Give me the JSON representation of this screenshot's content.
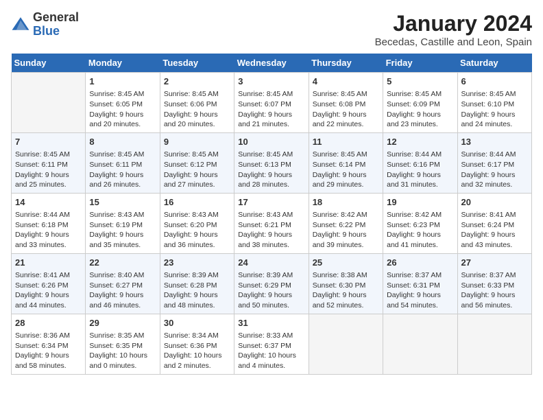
{
  "header": {
    "logo_line1": "General",
    "logo_line2": "Blue",
    "month_title": "January 2024",
    "subtitle": "Becedas, Castille and Leon, Spain"
  },
  "calendar": {
    "days_of_week": [
      "Sunday",
      "Monday",
      "Tuesday",
      "Wednesday",
      "Thursday",
      "Friday",
      "Saturday"
    ],
    "weeks": [
      [
        {
          "day": "",
          "info": ""
        },
        {
          "day": "1",
          "info": "Sunrise: 8:45 AM\nSunset: 6:05 PM\nDaylight: 9 hours\nand 20 minutes."
        },
        {
          "day": "2",
          "info": "Sunrise: 8:45 AM\nSunset: 6:06 PM\nDaylight: 9 hours\nand 20 minutes."
        },
        {
          "day": "3",
          "info": "Sunrise: 8:45 AM\nSunset: 6:07 PM\nDaylight: 9 hours\nand 21 minutes."
        },
        {
          "day": "4",
          "info": "Sunrise: 8:45 AM\nSunset: 6:08 PM\nDaylight: 9 hours\nand 22 minutes."
        },
        {
          "day": "5",
          "info": "Sunrise: 8:45 AM\nSunset: 6:09 PM\nDaylight: 9 hours\nand 23 minutes."
        },
        {
          "day": "6",
          "info": "Sunrise: 8:45 AM\nSunset: 6:10 PM\nDaylight: 9 hours\nand 24 minutes."
        }
      ],
      [
        {
          "day": "7",
          "info": "Sunrise: 8:45 AM\nSunset: 6:11 PM\nDaylight: 9 hours\nand 25 minutes."
        },
        {
          "day": "8",
          "info": "Sunrise: 8:45 AM\nSunset: 6:11 PM\nDaylight: 9 hours\nand 26 minutes."
        },
        {
          "day": "9",
          "info": "Sunrise: 8:45 AM\nSunset: 6:12 PM\nDaylight: 9 hours\nand 27 minutes."
        },
        {
          "day": "10",
          "info": "Sunrise: 8:45 AM\nSunset: 6:13 PM\nDaylight: 9 hours\nand 28 minutes."
        },
        {
          "day": "11",
          "info": "Sunrise: 8:45 AM\nSunset: 6:14 PM\nDaylight: 9 hours\nand 29 minutes."
        },
        {
          "day": "12",
          "info": "Sunrise: 8:44 AM\nSunset: 6:16 PM\nDaylight: 9 hours\nand 31 minutes."
        },
        {
          "day": "13",
          "info": "Sunrise: 8:44 AM\nSunset: 6:17 PM\nDaylight: 9 hours\nand 32 minutes."
        }
      ],
      [
        {
          "day": "14",
          "info": "Sunrise: 8:44 AM\nSunset: 6:18 PM\nDaylight: 9 hours\nand 33 minutes."
        },
        {
          "day": "15",
          "info": "Sunrise: 8:43 AM\nSunset: 6:19 PM\nDaylight: 9 hours\nand 35 minutes."
        },
        {
          "day": "16",
          "info": "Sunrise: 8:43 AM\nSunset: 6:20 PM\nDaylight: 9 hours\nand 36 minutes."
        },
        {
          "day": "17",
          "info": "Sunrise: 8:43 AM\nSunset: 6:21 PM\nDaylight: 9 hours\nand 38 minutes."
        },
        {
          "day": "18",
          "info": "Sunrise: 8:42 AM\nSunset: 6:22 PM\nDaylight: 9 hours\nand 39 minutes."
        },
        {
          "day": "19",
          "info": "Sunrise: 8:42 AM\nSunset: 6:23 PM\nDaylight: 9 hours\nand 41 minutes."
        },
        {
          "day": "20",
          "info": "Sunrise: 8:41 AM\nSunset: 6:24 PM\nDaylight: 9 hours\nand 43 minutes."
        }
      ],
      [
        {
          "day": "21",
          "info": "Sunrise: 8:41 AM\nSunset: 6:26 PM\nDaylight: 9 hours\nand 44 minutes."
        },
        {
          "day": "22",
          "info": "Sunrise: 8:40 AM\nSunset: 6:27 PM\nDaylight: 9 hours\nand 46 minutes."
        },
        {
          "day": "23",
          "info": "Sunrise: 8:39 AM\nSunset: 6:28 PM\nDaylight: 9 hours\nand 48 minutes."
        },
        {
          "day": "24",
          "info": "Sunrise: 8:39 AM\nSunset: 6:29 PM\nDaylight: 9 hours\nand 50 minutes."
        },
        {
          "day": "25",
          "info": "Sunrise: 8:38 AM\nSunset: 6:30 PM\nDaylight: 9 hours\nand 52 minutes."
        },
        {
          "day": "26",
          "info": "Sunrise: 8:37 AM\nSunset: 6:31 PM\nDaylight: 9 hours\nand 54 minutes."
        },
        {
          "day": "27",
          "info": "Sunrise: 8:37 AM\nSunset: 6:33 PM\nDaylight: 9 hours\nand 56 minutes."
        }
      ],
      [
        {
          "day": "28",
          "info": "Sunrise: 8:36 AM\nSunset: 6:34 PM\nDaylight: 9 hours\nand 58 minutes."
        },
        {
          "day": "29",
          "info": "Sunrise: 8:35 AM\nSunset: 6:35 PM\nDaylight: 10 hours\nand 0 minutes."
        },
        {
          "day": "30",
          "info": "Sunrise: 8:34 AM\nSunset: 6:36 PM\nDaylight: 10 hours\nand 2 minutes."
        },
        {
          "day": "31",
          "info": "Sunrise: 8:33 AM\nSunset: 6:37 PM\nDaylight: 10 hours\nand 4 minutes."
        },
        {
          "day": "",
          "info": ""
        },
        {
          "day": "",
          "info": ""
        },
        {
          "day": "",
          "info": ""
        }
      ]
    ]
  }
}
